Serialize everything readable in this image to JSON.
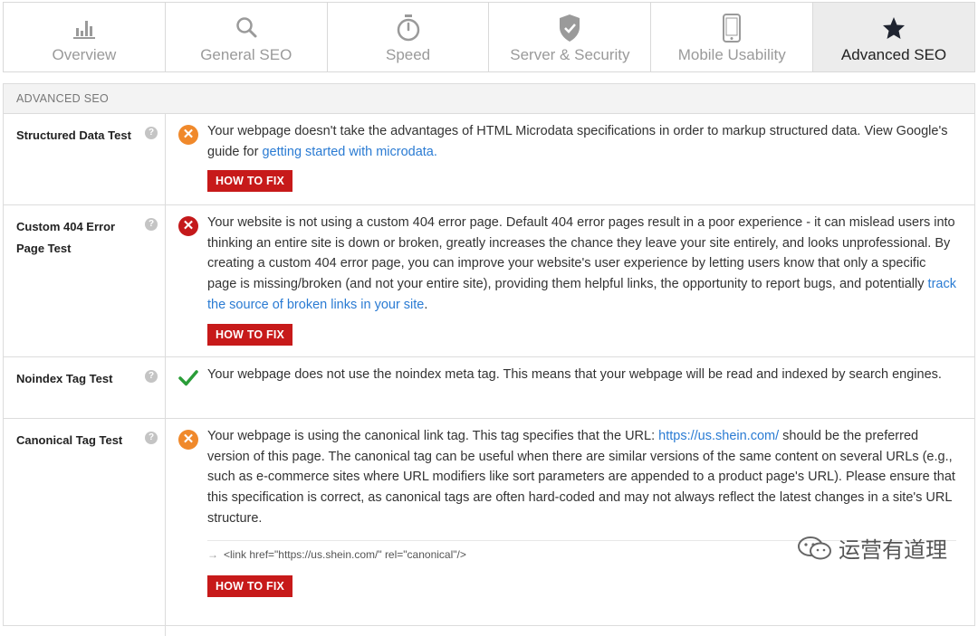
{
  "tabs": [
    {
      "label": "Overview",
      "icon": "bar-chart-icon"
    },
    {
      "label": "General SEO",
      "icon": "search-icon"
    },
    {
      "label": "Speed",
      "icon": "stopwatch-icon"
    },
    {
      "label": "Server & Security",
      "icon": "shield-check-icon"
    },
    {
      "label": "Mobile Usability",
      "icon": "mobile-phone-icon"
    },
    {
      "label": "Advanced SEO",
      "icon": "star-icon",
      "active": true
    }
  ],
  "section": {
    "title": "ADVANCED SEO",
    "rows": [
      {
        "label": "Structured Data Test",
        "status": "warning",
        "text": "Your webpage doesn't take the advantages of HTML Microdata specifications in order to markup structured data. View Google's guide for ",
        "link": "getting started with microdata.",
        "fix": "HOW TO FIX"
      },
      {
        "label": "Custom 404 Error Page Test",
        "status": "error",
        "text": "Your website is not using a custom 404 error page. Default 404 error pages result in a poor experience - it can mislead users into thinking an entire site is down or broken, greatly increases the chance they leave your site entirely, and looks unprofessional. By creating a custom 404 error page, you can improve your website's user experience by letting users know that only a specific page is missing/broken (and not your entire site), providing them helpful links, the opportunity to report bugs, and potentially ",
        "link": "track the source of broken links in your site",
        "text_after": ".",
        "fix": "HOW TO FIX"
      },
      {
        "label": "Noindex Tag Test",
        "status": "pass",
        "text": "Your webpage does not use the noindex meta tag. This means that your webpage will be read and indexed by search engines."
      },
      {
        "label": "Canonical Tag Test",
        "status": "warning",
        "text": "Your webpage is using the canonical link tag. This tag specifies that the URL: ",
        "link": "https://us.shein.com/",
        "text_after": " should be the preferred version of this page. The canonical tag can be useful when there are similar versions of the same content on several URLs (e.g., such as e-commerce sites where URL modifiers like sort parameters are appended to a product page's URL). Please ensure that this specification is correct, as canonical tags are often hard-coded and may not always reflect the latest changes in a site's URL structure.",
        "code": "<link href=\"https://us.shein.com/\" rel=\"canonical\"/>",
        "fix": "HOW TO FIX"
      }
    ]
  },
  "help_glyph": "?",
  "status_glyphs": {
    "warning": "✕",
    "error": "✕"
  },
  "code_arrow": "→",
  "watermark": {
    "text": "运营有道理",
    "icon": "wechat-icon"
  }
}
